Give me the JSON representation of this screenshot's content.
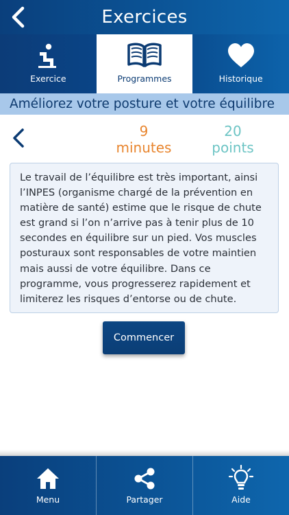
{
  "header": {
    "title": "Exercices",
    "back_icon": "chevron-left-icon"
  },
  "tabs": [
    {
      "label": "Exercice",
      "icon": "squat-person-icon",
      "active": false
    },
    {
      "label": "Programmes",
      "icon": "open-book-icon",
      "active": true
    },
    {
      "label": "Historique",
      "icon": "heart-icon",
      "active": false
    }
  ],
  "banner": {
    "title": "Améliorez votre posture et votre équilibre"
  },
  "stats": {
    "back_icon": "chevron-left-icon",
    "duration_value": "9",
    "duration_unit": "minutes",
    "points_value": "20",
    "points_unit": "points"
  },
  "description": "Le travail de l’équilibre est très important, ainsi l’INPES (organisme chargé de la prévention en matière de santé) estime que le risque de chute est grand si l’on n’arrive pas à tenir plus de 10 secondes en équilibre sur un pied. Vos muscles posturaux sont responsables de votre maintien mais aussi de votre équilibre. Dans ce programme, vous progresserez rapidement et limiterez les risques d’entorse ou de chute.",
  "start_button": {
    "label": "Commencer"
  },
  "bottom_nav": [
    {
      "label": "Menu",
      "icon": "home-icon"
    },
    {
      "label": "Partager",
      "icon": "share-icon"
    },
    {
      "label": "Aide",
      "icon": "lightbulb-icon"
    }
  ],
  "colors": {
    "primary": "#0b4a8c",
    "banner_bg": "#a8c8ea",
    "duration": "#e8852e",
    "points": "#6cc4c4"
  }
}
